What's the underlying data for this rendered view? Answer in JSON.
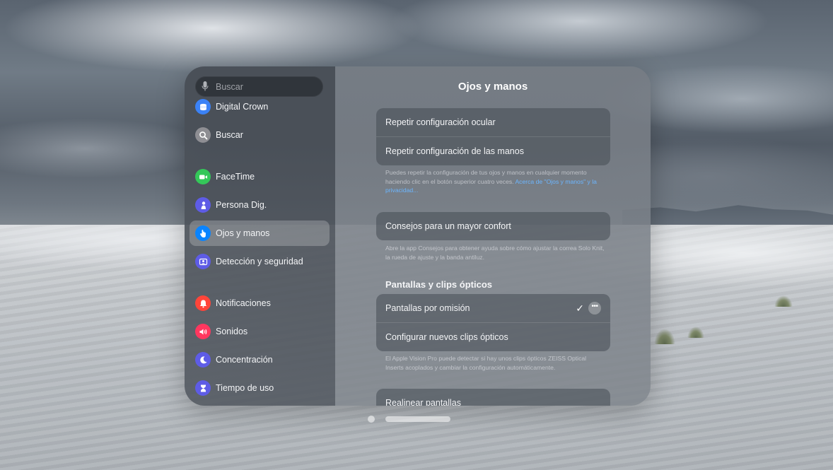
{
  "search": {
    "placeholder": "Buscar",
    "icon": "mic-icon"
  },
  "sidebar": {
    "items": [
      {
        "label": "Digital Crown",
        "icon": "digital-crown-icon",
        "color": "#3b82f6"
      },
      {
        "label": "Buscar",
        "icon": "search-icon",
        "color": "#8e8e93"
      },
      {
        "label": "FaceTime",
        "icon": "video-camera-icon",
        "color": "#34c759"
      },
      {
        "label": "Persona Dig.",
        "icon": "persona-icon",
        "color": "#5e5ce6"
      },
      {
        "label": "Ojos y manos",
        "icon": "hand-icon",
        "color": "#0a84ff",
        "selected": true
      },
      {
        "label": "Detección y seguridad",
        "icon": "detection-icon",
        "color": "#5e5ce6"
      },
      {
        "label": "Notificaciones",
        "icon": "bell-icon",
        "color": "#ff453a"
      },
      {
        "label": "Sonidos",
        "icon": "speaker-icon",
        "color": "#ff375f"
      },
      {
        "label": "Concentración",
        "icon": "moon-icon",
        "color": "#5e5ce6"
      },
      {
        "label": "Tiempo de uso",
        "icon": "hourglass-icon",
        "color": "#5e5ce6"
      }
    ]
  },
  "main": {
    "title": "Ojos y manos",
    "group1": {
      "rows": [
        "Repetir configuración ocular",
        "Repetir configuración de las manos"
      ],
      "note": "Puedes repetir la configuración de tus ojos y manos en cualquier momento haciendo clic en el botón superior cuatro veces. ",
      "note_link": "Acerca de \"Ojos y manos\" y la privacidad..."
    },
    "group2": {
      "rows": [
        "Consejos para un mayor confort"
      ],
      "note": "Abre la app Consejos para obtener ayuda sobre cómo ajustar la correa Solo Knit, la rueda de ajuste y la banda antiluz."
    },
    "section_header": "Pantallas y clips ópticos",
    "group3": {
      "rows": [
        "Pantallas por omisión",
        "Configurar nuevos clips ópticos"
      ],
      "note": "El Apple Vision Pro puede detectar si hay unos clips ópticos ZEISS Optical Inserts acoplados y cambiar la configuración automáticamente."
    },
    "group4": {
      "rows": [
        "Realinear pantallas"
      ]
    }
  },
  "colors": {
    "link": "#6cb6ff"
  }
}
